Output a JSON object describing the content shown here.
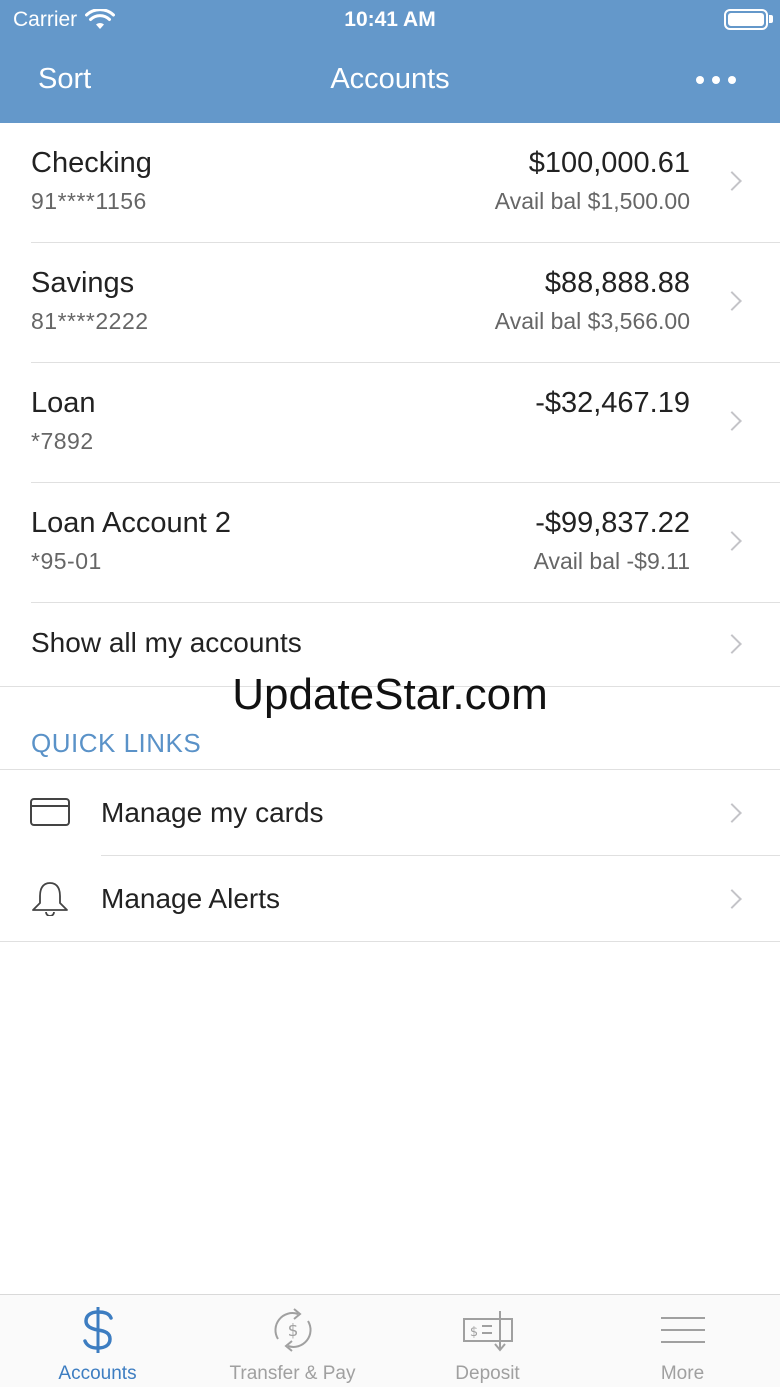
{
  "status_bar": {
    "carrier": "Carrier",
    "time": "10:41 AM"
  },
  "nav": {
    "sort_label": "Sort",
    "title": "Accounts"
  },
  "accounts": [
    {
      "name": "Checking",
      "number": "91****1156",
      "balance": "$100,000.61",
      "avail": "Avail bal $1,500.00"
    },
    {
      "name": "Savings",
      "number": "81****2222",
      "balance": "$88,888.88",
      "avail": "Avail bal $3,566.00"
    },
    {
      "name": "Loan",
      "number": "*7892",
      "balance": "-$32,467.19",
      "avail": ""
    },
    {
      "name": "Loan Account 2",
      "number": "*95-01",
      "balance": "-$99,837.22",
      "avail": "Avail bal -$9.11"
    }
  ],
  "show_all_label": "Show all my accounts",
  "watermark": "UpdateStar.com",
  "quick_links": {
    "header": "QUICK LINKS",
    "items": [
      {
        "label": "Manage my cards",
        "icon": "credit-card-icon"
      },
      {
        "label": "Manage Alerts",
        "icon": "bell-icon"
      }
    ]
  },
  "tabs": [
    {
      "label": "Accounts",
      "icon": "dollar-icon",
      "active": true
    },
    {
      "label": "Transfer & Pay",
      "icon": "transfer-icon",
      "active": false
    },
    {
      "label": "Deposit",
      "icon": "deposit-check-icon",
      "active": false
    },
    {
      "label": "More",
      "icon": "menu-icon",
      "active": false
    }
  ],
  "colors": {
    "header": "#6498ca",
    "accent": "#3d7dc1",
    "quick_links": "#5a92c8"
  }
}
